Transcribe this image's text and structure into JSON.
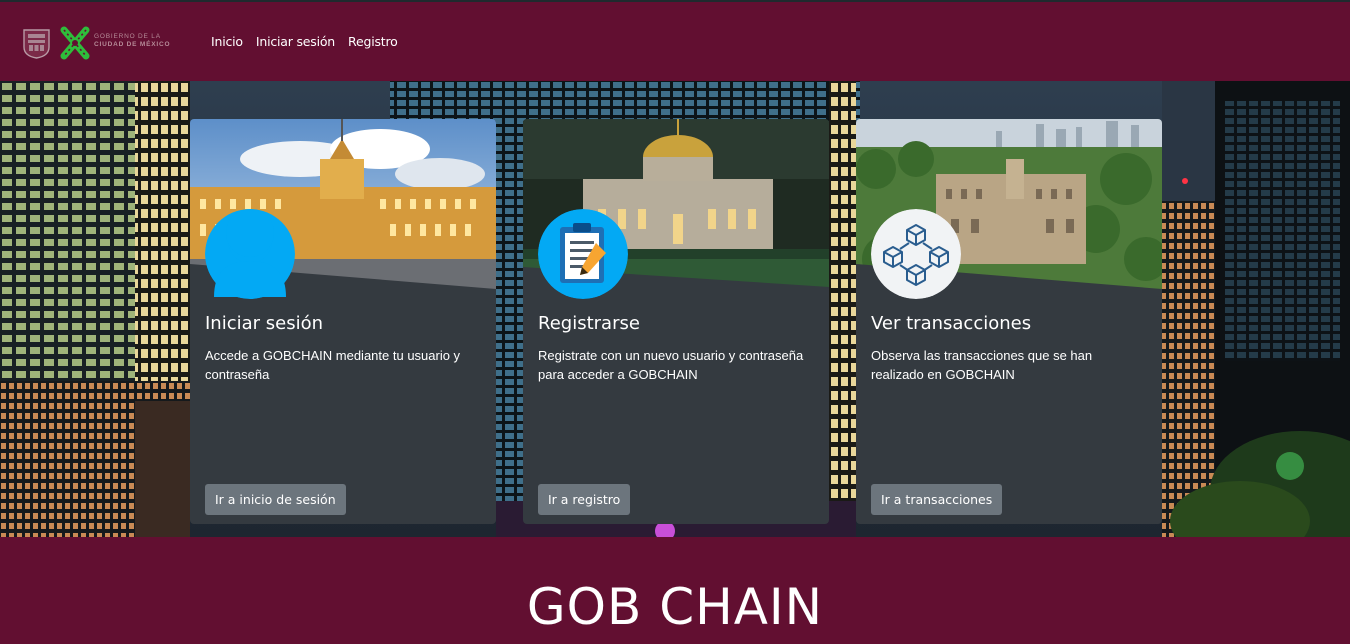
{
  "logo": {
    "line1": "Gobierno de la",
    "line2": "Ciudad de México"
  },
  "nav": {
    "items": [
      {
        "label": "Inicio"
      },
      {
        "label": "Iniciar sesión"
      },
      {
        "label": "Registro"
      }
    ]
  },
  "cards": [
    {
      "title": "Iniciar sesión",
      "text": "Accede a GOBCHAIN mediante tu usuario y contraseña",
      "button": "Ir a inicio de sesión",
      "icon": "user-icon"
    },
    {
      "title": "Registrarse",
      "text": "Registrate con un nuevo usuario y contraseña para acceder a GOBCHAIN",
      "button": "Ir a registro",
      "icon": "clipboard-icon"
    },
    {
      "title": "Ver transacciones",
      "text": "Observa las transacciones que se han realizado en GOBCHAIN",
      "button": "Ir a transacciones",
      "icon": "blockchain-icon"
    }
  ],
  "footer": {
    "title": "GOB CHAIN"
  },
  "colors": {
    "brand": "#620f31",
    "card": "#343a40",
    "button": "#6c757d",
    "avatar_blue": "#03a9f4"
  }
}
